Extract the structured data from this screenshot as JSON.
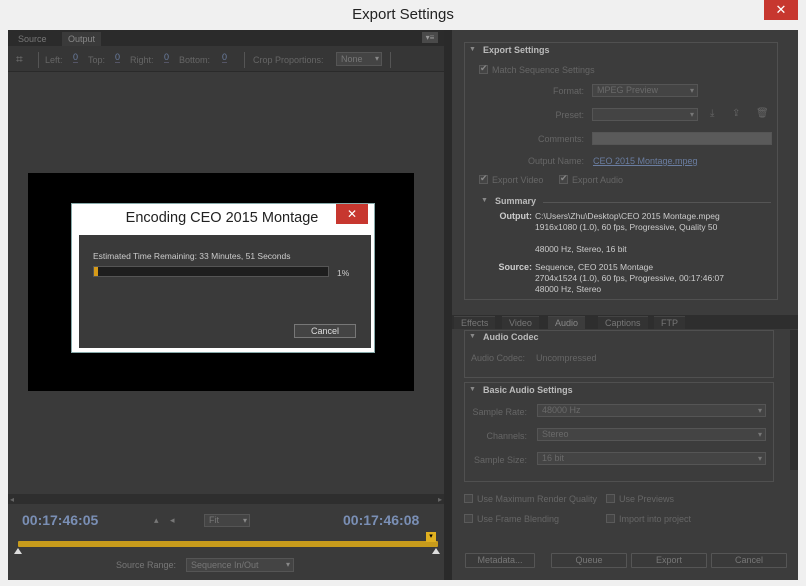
{
  "window": {
    "title": "Export Settings",
    "close_glyph": "✕"
  },
  "left": {
    "tabs": [
      "Source",
      "Output"
    ],
    "panel_menu_glyph": "▾≡",
    "crop": {
      "left_label": "Left:",
      "left_value": "0",
      "top_label": "Top:",
      "top_value": "0",
      "right_label": "Right:",
      "right_value": "0",
      "bottom_label": "Bottom:",
      "bottom_value": "0",
      "proportions_label": "Crop Proportions:",
      "proportions_value": "None"
    },
    "timecode_in": "00:17:46:05",
    "timecode_out": "00:17:46:08",
    "fit_value": "Fit",
    "source_range_label": "Source Range:",
    "source_range_value": "Sequence In/Out"
  },
  "export_settings": {
    "header": "Export Settings",
    "match_sequence_label": "Match Sequence Settings",
    "format_label": "Format:",
    "format_value": "MPEG Preview",
    "preset_label": "Preset:",
    "preset_value": "",
    "comments_label": "Comments:",
    "output_name_label": "Output Name:",
    "output_name_value": "CEO 2015 Montage.mpeg",
    "export_video_label": "Export Video",
    "export_audio_label": "Export Audio"
  },
  "summary": {
    "header": "Summary",
    "output_label": "Output:",
    "output_lines": [
      "C:\\Users\\Zhu\\Desktop\\CEO 2015 Montage.mpeg",
      "1916x1080 (1.0), 60 fps, Progressive, Quality 50",
      "",
      "48000 Hz, Stereo, 16 bit"
    ],
    "source_label": "Source:",
    "source_lines": [
      "Sequence, CEO 2015 Montage",
      "2704x1524 (1.0), 60 fps, Progressive, 00:17:46:07",
      "48000 Hz, Stereo"
    ]
  },
  "right_tabs": [
    "Effects",
    "Video",
    "Audio",
    "Captions",
    "FTP"
  ],
  "audio_codec": {
    "header": "Audio Codec",
    "label": "Audio Codec:",
    "value": "Uncompressed"
  },
  "basic_audio": {
    "header": "Basic Audio Settings",
    "sample_rate_label": "Sample Rate:",
    "sample_rate_value": "48000 Hz",
    "channels_label": "Channels:",
    "channels_value": "Stereo",
    "sample_size_label": "Sample Size:",
    "sample_size_value": "16 bit"
  },
  "options": {
    "max_render_quality": "Use Maximum Render Quality",
    "use_previews": "Use Previews",
    "frame_blending": "Use Frame Blending",
    "import_into_project": "Import into project"
  },
  "buttons": {
    "metadata": "Metadata...",
    "queue": "Queue",
    "export": "Export",
    "cancel": "Cancel"
  },
  "dialog": {
    "title": "Encoding CEO 2015 Montage",
    "close_glyph": "✕",
    "estimate": "Estimated Time Remaining: 33 Minutes, 51 Seconds",
    "progress_percent": 1,
    "progress_label": "1%",
    "cancel_label": "Cancel"
  },
  "colors": {
    "accent": "#d69a18",
    "close_red": "#c7372f",
    "timecode_blue": "#7a8fb5"
  }
}
